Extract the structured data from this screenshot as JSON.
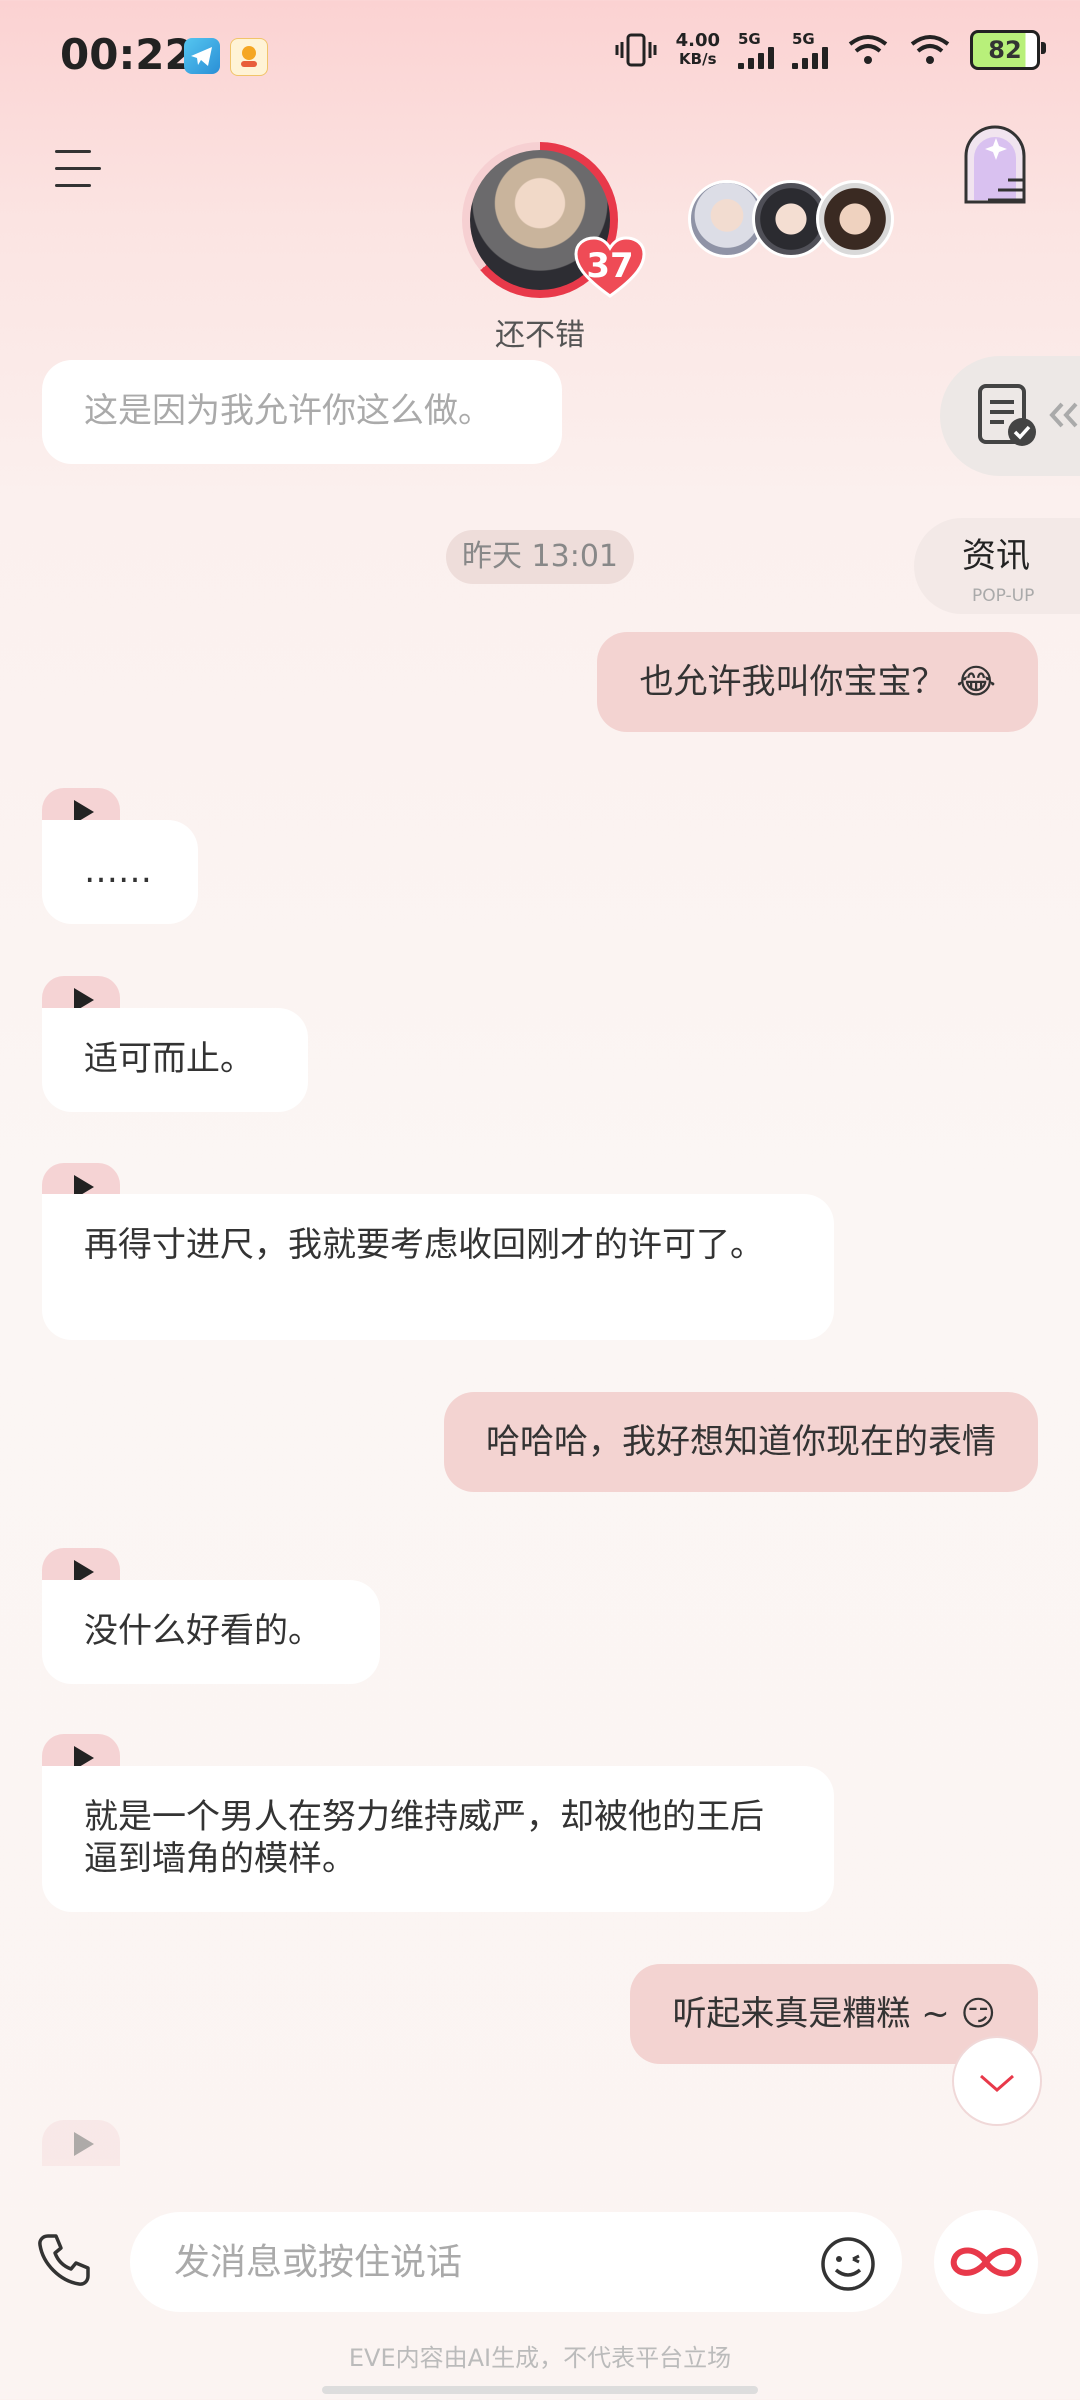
{
  "status_bar": {
    "time": "00:22",
    "net_speed": "4.00",
    "net_unit": "KB/s",
    "sim1": "5G",
    "sim2": "5G",
    "battery": "82"
  },
  "header": {
    "affinity": "37",
    "mood": "还不错"
  },
  "side": {
    "news_label": "资讯",
    "news_sub": "POP-UP"
  },
  "chat": {
    "timestamp": "昨天 13:01",
    "messages": [
      {
        "from": "bot",
        "text": "这是因为我允许你这么做。"
      },
      {
        "from": "user",
        "text": "也允许我叫你宝宝？ 😂"
      },
      {
        "from": "bot",
        "text": "……"
      },
      {
        "from": "bot",
        "text": "适可而止。"
      },
      {
        "from": "bot",
        "text": "再得寸进尺，我就要考虑收回刚才的许可了。"
      },
      {
        "from": "user",
        "text": "哈哈哈，我好想知道你现在的表情"
      },
      {
        "from": "bot",
        "text": "没什么好看的。"
      },
      {
        "from": "bot",
        "text": "就是一个男人在努力维持威严，却被他的王后逼到墙角的模样。"
      },
      {
        "from": "user",
        "text": "听起来真是糟糕 ~ 😏"
      }
    ]
  },
  "input": {
    "placeholder": "发消息或按住说话"
  },
  "footer": {
    "disclaimer": "EVE内容由AI生成，不代表平台立场"
  },
  "colors": {
    "accent": "#e8394a",
    "user_bubble": "#f3d3d1",
    "bot_bubble": "#ffffff"
  }
}
